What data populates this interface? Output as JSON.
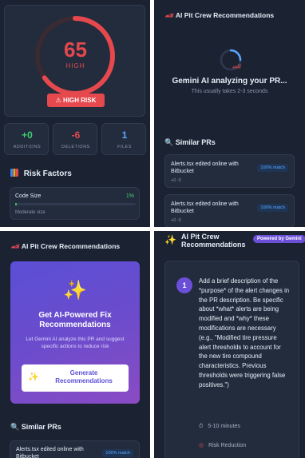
{
  "colors": {
    "panel_bg": "#1b2333",
    "card_bg": "#222c3d",
    "risk_red": "#e5484d",
    "success_green": "#3ecf6e",
    "accent_blue": "#5aa7ff",
    "purple_gradient_start": "#5b4fd6",
    "purple_gradient_end": "#8b4bc4"
  },
  "risk_panel": {
    "score": "65",
    "level": "HIGH",
    "badge": "HIGH RISK",
    "score_fraction": 0.65,
    "stats": [
      {
        "value": "+0",
        "label": "ADDITIONS"
      },
      {
        "value": "-6",
        "label": "DELETIONS"
      },
      {
        "value": "1",
        "label": "FILES"
      }
    ],
    "risk_factors_title": "Risk Factors",
    "factor": {
      "name": "Code Size",
      "percent": "1%",
      "note": "Moderate size",
      "fraction": 0.01
    }
  },
  "loading_panel": {
    "title": "AI Pit Crew Recommendations",
    "status": "Gemini AI analyzing your PR...",
    "substatus": "This usually takes 2-3 seconds",
    "similar_title": "Similar PRs",
    "similar": [
      {
        "title": "Alerts.tsx edited online with Bitbucket",
        "match": "100% match",
        "diff": "+0 -0"
      },
      {
        "title": "Alerts.tsx edited online with Bitbucket",
        "match": "100% match",
        "diff": "+0 -0"
      }
    ]
  },
  "cta_panel": {
    "title": "AI Pit Crew Recommendations",
    "cta_title": "Get AI-Powered Fix Recommendations",
    "cta_desc": "Let Gemini AI analyze this PR and suggest specific actions to reduce risk",
    "button_label": "Generate Recommendations",
    "similar_title": "Similar PRs",
    "similar_item": "Alerts.tsx edited online with Bitbucket",
    "similar_match": "100% match"
  },
  "reco_panel": {
    "title": "AI Pit Crew Recommendations",
    "badge": "Powered by Gemini",
    "step_number": "1",
    "recommendation": "Add a brief description of the *purpose* of the alert changes in the PR description. Be specific about *what* alerts are being modified and *why* these modifications are necessary (e.g., \"Modified tire pressure alert thresholds to account for the new tire compound characteristics. Previous thresholds were triggering false positives.\")",
    "time": "5-10 minutes",
    "impact": "Risk Reduction"
  }
}
